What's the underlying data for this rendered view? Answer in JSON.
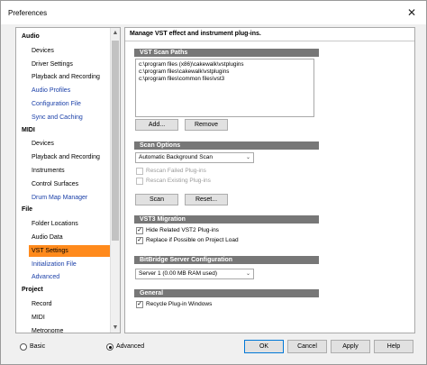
{
  "window": {
    "title": "Preferences",
    "close_glyph": "✕"
  },
  "tree": {
    "items": [
      {
        "type": "cat",
        "label": "Audio"
      },
      {
        "type": "item",
        "label": "Devices"
      },
      {
        "type": "item",
        "label": "Driver Settings"
      },
      {
        "type": "item",
        "label": "Playback and Recording"
      },
      {
        "type": "link",
        "label": "Audio Profiles"
      },
      {
        "type": "link",
        "label": "Configuration File"
      },
      {
        "type": "link",
        "label": "Sync and Caching"
      },
      {
        "type": "cat",
        "label": "MIDI"
      },
      {
        "type": "item",
        "label": "Devices"
      },
      {
        "type": "item",
        "label": "Playback and Recording"
      },
      {
        "type": "item",
        "label": "Instruments"
      },
      {
        "type": "item",
        "label": "Control Surfaces"
      },
      {
        "type": "link",
        "label": "Drum Map Manager"
      },
      {
        "type": "cat",
        "label": "File"
      },
      {
        "type": "item",
        "label": "Folder Locations"
      },
      {
        "type": "item",
        "label": "Audio Data"
      },
      {
        "type": "selected",
        "label": "VST Settings"
      },
      {
        "type": "link",
        "label": "Initialization File"
      },
      {
        "type": "link",
        "label": "Advanced"
      },
      {
        "type": "cat",
        "label": "Project"
      },
      {
        "type": "item",
        "label": "Record"
      },
      {
        "type": "item",
        "label": "MIDI"
      },
      {
        "type": "item",
        "label": "Metronome"
      }
    ],
    "scroll_up": "▲",
    "scroll_down": "▼"
  },
  "pane": {
    "description": "Manage VST effect and instrument plug-ins.",
    "scan_paths": {
      "header": "VST Scan Paths",
      "paths": [
        "c:\\program files (x86)\\cakewalk\\vstplugins",
        "c:\\program files\\cakewalk\\vstplugins",
        "c:\\program files\\common files\\vst3"
      ],
      "add_label": "Add...",
      "remove_label": "Remove"
    },
    "scan_options": {
      "header": "Scan Options",
      "mode_value": "Automatic Background Scan",
      "rescan_failed": "Rescan Failed Plug-ins",
      "rescan_existing": "Rescan Existing Plug-ins",
      "scan_label": "Scan",
      "reset_label": "Reset..."
    },
    "vst3": {
      "header": "VST3 Migration",
      "hide_related": "Hide Related VST2 Plug-ins",
      "replace": "Replace if Possible on Project Load"
    },
    "bitbridge": {
      "header": "BitBridge Server Configuration",
      "server_value": "Server 1  (0.00  MB RAM used)"
    },
    "general": {
      "header": "General",
      "recycle": "Recycle Plug-in Windows"
    },
    "combo_arrow": "⌄",
    "check_glyph": "✓"
  },
  "footer": {
    "basic_label": "Basic",
    "advanced_label": "Advanced",
    "ok_label": "OK",
    "cancel_label": "Cancel",
    "apply_label": "Apply",
    "help_label": "Help"
  }
}
